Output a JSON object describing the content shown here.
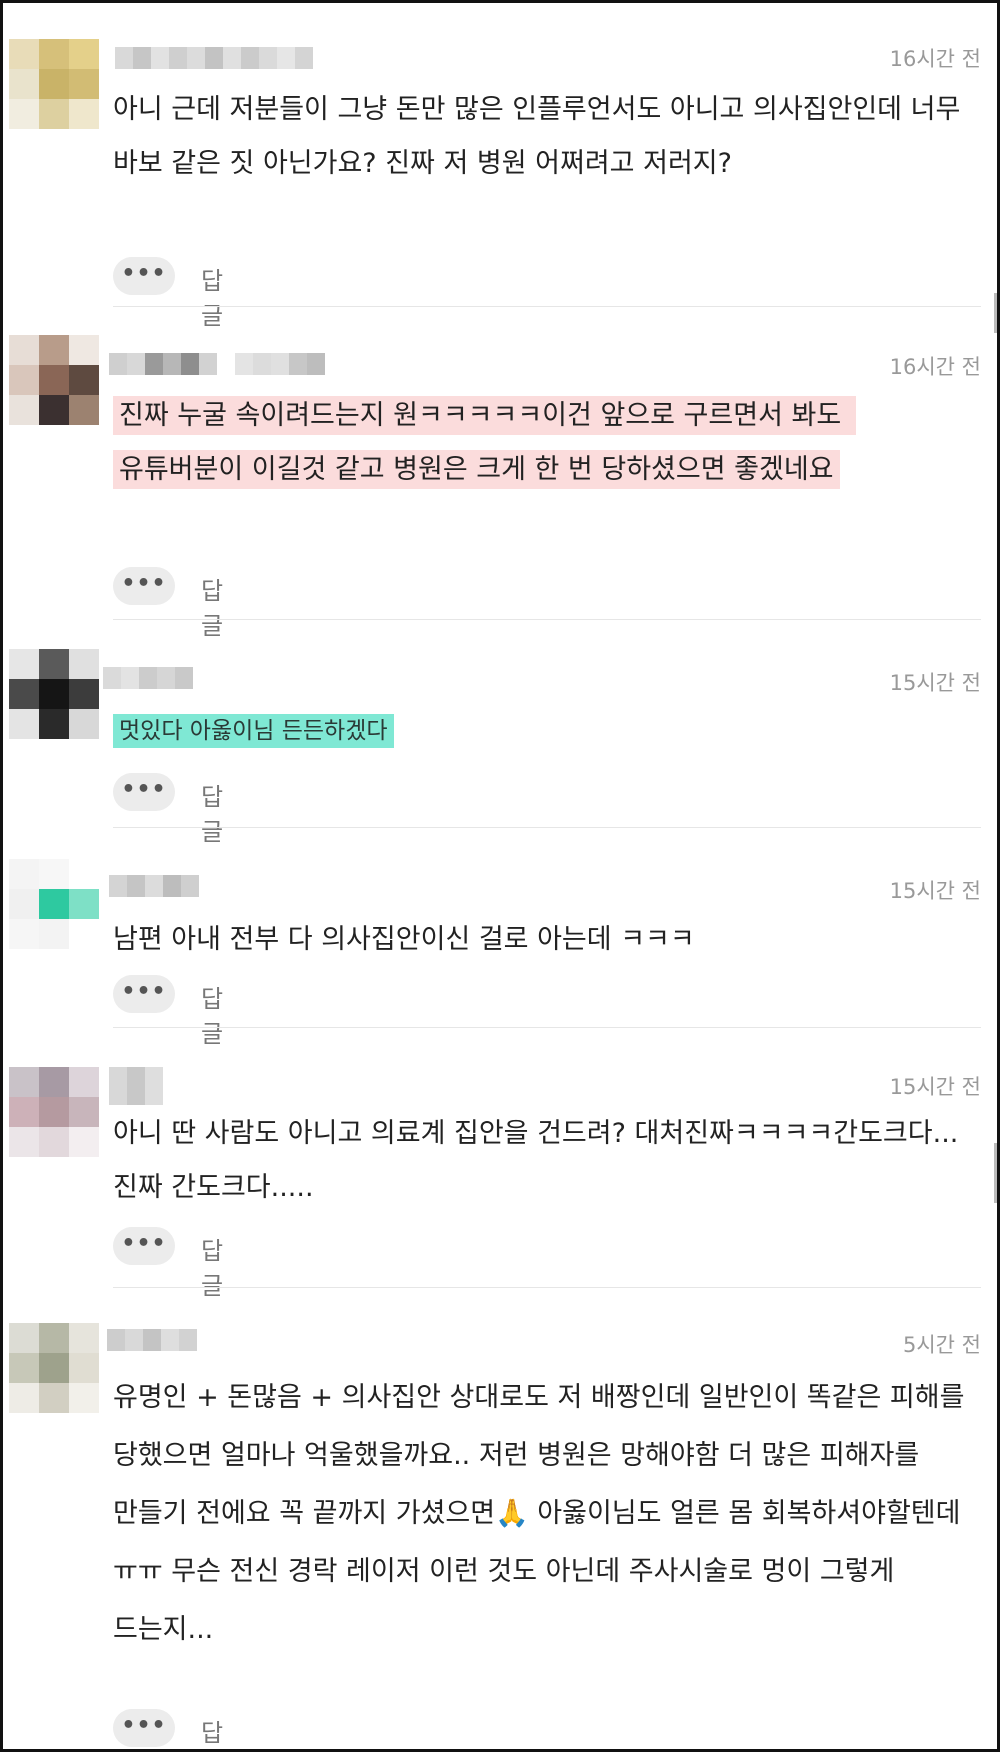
{
  "comments": [
    {
      "time": "16시간 전",
      "text": "아니 근데 저분들이 그냥 돈만 많은 인플루언서도 아니고 의사집안인데 너무 바보 같은 짓 아닌가요? 진짜 저 병원 어쩌려고 저러지?",
      "more": "•••",
      "reply": "답글"
    },
    {
      "time": "16시간 전",
      "text": "진짜 누굴 속이려드는지 원ㅋㅋㅋㅋㅋ이건 앞으로 구르면서 봐도 유튜버분이 이길것 같고 병원은 크게 한 번 당하셨으면 좋겠네요",
      "more": "•••",
      "reply": "답글"
    },
    {
      "time": "15시간 전",
      "text": "멋있다 아옳이님 든든하겠다",
      "more": "•••",
      "reply": "답글"
    },
    {
      "time": "15시간 전",
      "text": "남편 아내 전부 다 의사집안이신 걸로 아는데 ㅋㅋㅋ",
      "more": "•••",
      "reply": "답글"
    },
    {
      "time": "15시간 전",
      "text": "아니 딴 사람도 아니고 의료계 집안을 건드려? 대처진짜ㅋㅋㅋㅋ간도크다...진짜 간도크다.....",
      "more": "•••",
      "reply": "답글"
    },
    {
      "time": "5시간 전",
      "text": "유명인 + 돈많음 + 의사집안 상대로도 저 배짱인데 일반인이 똑같은 피해를 당했으면 얼마나 억울했을까요.. 저런 병원은 망해야함 더 많은 피해자를 만들기 전에요 꼭 끝까지 가셨으면🙏 아옳이님도 얼른 몸 회복하셔야할텐데 ㅠㅠ 무슨 전신 경락 레이저 이런 것도 아닌데 주사시술로 멍이 그렇게 드는지...",
      "more": "•••",
      "reply": "답글"
    }
  ],
  "colors": {
    "highlight_pink": "#fbdcdc",
    "highlight_teal": "#7fe8d4",
    "time_gray": "#999999",
    "divider": "#e6e6e6"
  }
}
